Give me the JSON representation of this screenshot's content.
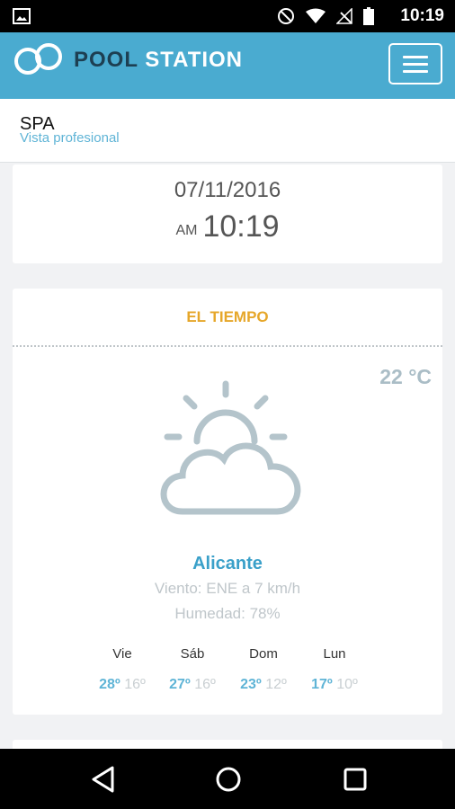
{
  "status_bar": {
    "time": "10:19",
    "icons": [
      "image-icon",
      "do-not-disturb-icon",
      "wifi-icon",
      "no-signal-icon",
      "battery-icon"
    ]
  },
  "app_bar": {
    "brand_pool": "POOL",
    "brand_station": "STATION",
    "logo": "infinity-logo-icon",
    "menu_icon": "hamburger-menu-icon",
    "color": "#4aabd0"
  },
  "subheader": {
    "name": "SPA",
    "subtitle": "Vista profesional"
  },
  "datetime": {
    "date": "07/11/2016",
    "ampm": "AM",
    "time": "10:19"
  },
  "weather": {
    "title": "EL TIEMPO",
    "temperature": "22 °C",
    "icon": "partly-cloudy-icon",
    "city": "Alicante",
    "wind": "Viento: ENE a 7 km/h",
    "humidity": "Humedad: 78%",
    "forecast": [
      {
        "day": "Vie",
        "high": "28º",
        "low": "16º"
      },
      {
        "day": "Sáb",
        "high": "27º",
        "low": "16º"
      },
      {
        "day": "Dom",
        "high": "23º",
        "low": "12º"
      },
      {
        "day": "Lun",
        "high": "17º",
        "low": "10º"
      }
    ]
  },
  "nav_bar": {
    "icons": [
      "back-icon",
      "home-icon",
      "recent-apps-icon"
    ]
  }
}
